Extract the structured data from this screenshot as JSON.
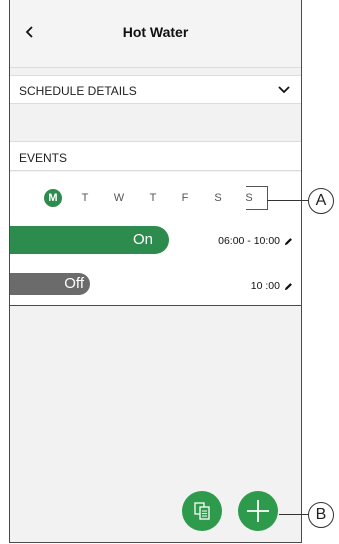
{
  "header": {
    "title": "Hot Water",
    "back_icon": "chevron-left-icon"
  },
  "schedule": {
    "label": "SCHEDULE DETAILS",
    "toggle_icon": "chevron-down-icon"
  },
  "events": {
    "label": "EVENTS",
    "days": [
      "M",
      "T",
      "W",
      "T",
      "F",
      "S",
      "S"
    ],
    "selected_day": "M",
    "items": [
      {
        "state": "On",
        "time": "06:00 - 10:00",
        "edit_icon": "pencil-icon"
      },
      {
        "state": "Off",
        "time": "10 :00",
        "edit_icon": "pencil-icon"
      }
    ]
  },
  "actions": {
    "copy_icon": "copy-icon",
    "add_icon": "plus-icon"
  },
  "callouts": [
    "A",
    "B"
  ],
  "colors": {
    "accent": "#2e8b4e",
    "off": "#6b6b6b",
    "fab": "#2e9a4c"
  }
}
